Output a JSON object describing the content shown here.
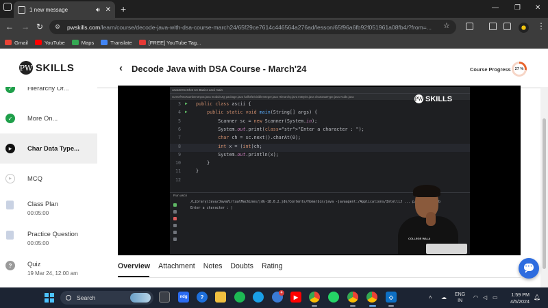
{
  "browser": {
    "tab_title": "1 new message",
    "tab_sound_icon": "speaker-icon",
    "new_tab": "+",
    "url_host": "pwskills.com",
    "url_path": "/learn/course/decode-java-with-dsa-course-march24/65f29ce7614c446564a276ad/lesson/65f96a6fb92f051961a08fb4/?from=...",
    "bookmarks": [
      {
        "label": "Gmail",
        "color": "#ea4335"
      },
      {
        "label": "YouTube",
        "color": "#ff0000"
      },
      {
        "label": "Maps",
        "color": "#34a853"
      },
      {
        "label": "Translate",
        "color": "#4285f4"
      },
      {
        "label": "[FREE] YouTube Tag...",
        "color": "#e53935"
      }
    ]
  },
  "header": {
    "logo_mark": "PW",
    "logo_text": "SKILLS",
    "back_icon": "chevron-left-icon",
    "course_title": "Decode Java with DSA Course - March'24",
    "progress_label": "Course Progress",
    "progress_value": "27 %",
    "progress_fraction": 0.27,
    "accent_color": "#e8632b"
  },
  "sidebar": {
    "items": [
      {
        "title": "Hierarchy Of...",
        "sub": "",
        "status": "done"
      },
      {
        "title": "More On...",
        "sub": "",
        "status": "done"
      },
      {
        "title": "Char Data Type...",
        "sub": "",
        "status": "playing"
      },
      {
        "title": "MCQ",
        "sub": "",
        "status": "pending"
      },
      {
        "title": "Class Plan",
        "sub": "00:05:00",
        "status": "doc"
      },
      {
        "title": "Practice Question",
        "sub": "00:05:00",
        "status": "doc"
      },
      {
        "title": "Quiz",
        "sub": "19 Mar 24, 12:00 am",
        "status": "quiz"
      }
    ]
  },
  "video": {
    "ide_breadcrumb": "JavaInOneShot  src  Basics  ascii  main",
    "ide_tabs": "sumOfTwoNumbersInput.java   moduleJQ package.java   halfOfDivisibleInteger.java   Hierarchy.java   IntByint.java   charDataType.java   Aside.java",
    "watermark_mark": "PW",
    "watermark_text": "SKILLS",
    "code_lines": [
      {
        "num": "3",
        "text": "public class ascii {"
      },
      {
        "num": "4",
        "text": "    public static void main(String[] args) {"
      },
      {
        "num": "5",
        "text": "        Scanner sc = new Scanner(System.in);"
      },
      {
        "num": "6",
        "text": "        System.out.print(\"Enter a character : \");"
      },
      {
        "num": "7",
        "text": "        char ch = sc.next().charAt(0);"
      },
      {
        "num": "8",
        "text": "        int x = (int)ch;"
      },
      {
        "num": "9",
        "text": "        System.out.println(x);"
      },
      {
        "num": "10",
        "text": "    }"
      },
      {
        "num": "11",
        "text": "}"
      },
      {
        "num": "12",
        "text": ""
      }
    ],
    "run_label": "Run    ascii",
    "console_1": "/Library/Java/JavaVirtualMachines/jdk-18.0.2.jdk/Contents/Home/bin/java -javaagent:/Applications/IntelliJ ... p/Contents/lib",
    "console_2": "Enter a character : |",
    "presenter_shirt_text": "COLLEGE WALA"
  },
  "tabs": [
    {
      "label": "Overview",
      "active": true
    },
    {
      "label": "Attachment",
      "active": false
    },
    {
      "label": "Notes",
      "active": false
    },
    {
      "label": "Doubts",
      "active": false
    },
    {
      "label": "Rating",
      "active": false
    }
  ],
  "taskbar": {
    "search_label": "Search",
    "lang_1": "ENG",
    "lang_2": "IN",
    "time": "1:59 PM",
    "date": "4/5/2024",
    "badge": "4"
  }
}
